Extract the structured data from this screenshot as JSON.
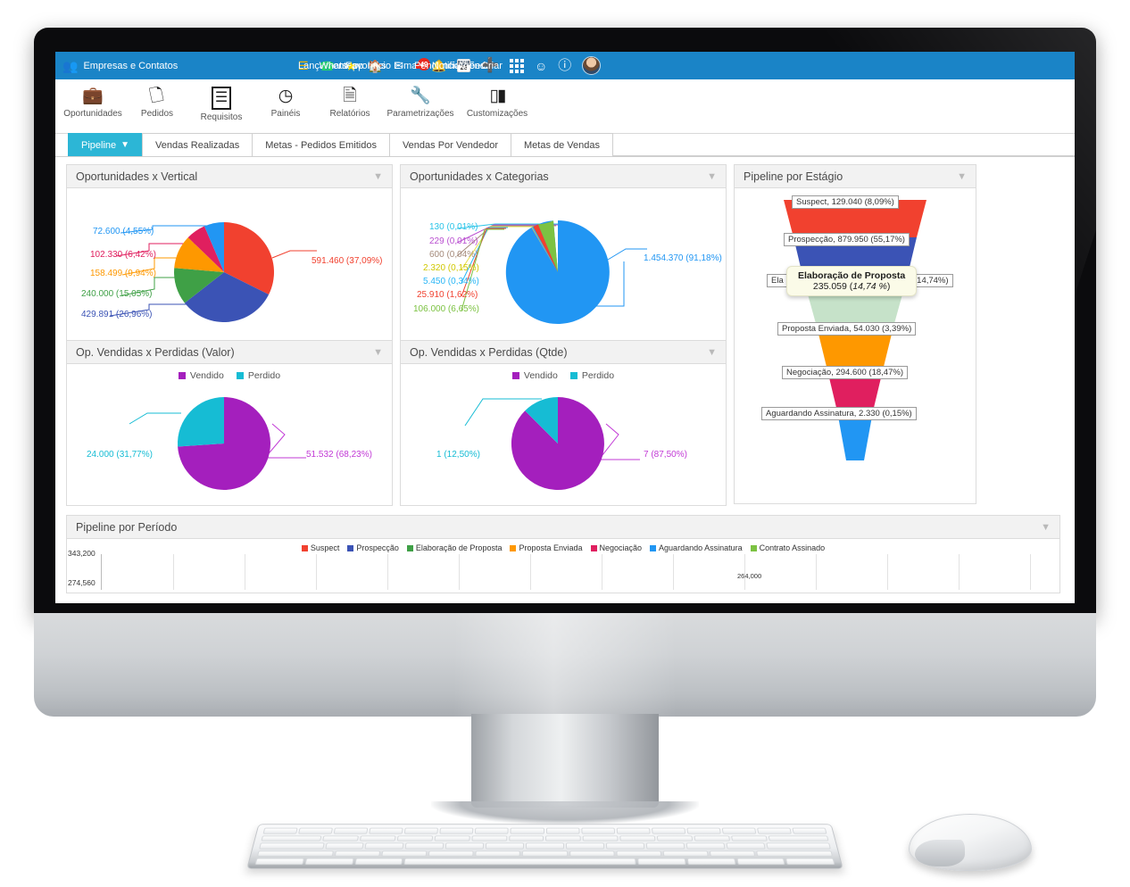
{
  "topbar": {
    "brand_label": "Empresas e Contatos",
    "brand_icon": "people-icon",
    "items": [
      {
        "label": "Lançamentos",
        "icon": "book-icon",
        "color": "#f0b400"
      },
      {
        "label": "Whatsapp",
        "icon": "whatsapp-icon",
        "color": "#25d366"
      },
      {
        "label": "Favoritos",
        "icon": "star-icon",
        "color": "#ffdd00"
      },
      {
        "label": "Início",
        "icon": "home-icon",
        "color": "#ffffff"
      },
      {
        "label": "E-mails",
        "icon": "envelope-icon",
        "color": "#ffffff"
      },
      {
        "label": "Pendências",
        "icon": "pending-icon",
        "color": "#e8281e",
        "badge": "49"
      },
      {
        "label": "Notificações",
        "icon": "bell-icon",
        "color": "#ffffff"
      },
      {
        "label": "Agenda",
        "icon": "calendar-icon",
        "color": "#ffffff",
        "cal_top": "Qui",
        "cal_day": "26"
      },
      {
        "label": "Criar",
        "icon": "plus-icon",
        "color": "#ffffff"
      }
    ],
    "apps_icon": "apps-grid-icon",
    "broadcast_icon": "user-broadcast-icon",
    "help_icon": "question-circle-icon",
    "avatar_icon": "avatar",
    "bg_color": "#1a84c7"
  },
  "module_toolbar": [
    {
      "label": "Oportunidades",
      "icon": "briefcase-icon",
      "glyph": "💼"
    },
    {
      "label": "Pedidos",
      "icon": "invoice-icon",
      "glyph": "🗒"
    },
    {
      "label": "Requisitos",
      "icon": "list-doc-icon",
      "glyph": "☰"
    },
    {
      "label": "Painéis",
      "icon": "gauge-icon",
      "glyph": "◔"
    },
    {
      "label": "Relatórios",
      "icon": "report-icon",
      "glyph": "🗎"
    },
    {
      "label": "Parametrizações",
      "icon": "wrench-icon",
      "glyph": "🔧"
    },
    {
      "label": "Customizações",
      "icon": "sliders-icon",
      "glyph": "▯▮"
    }
  ],
  "tabs": [
    {
      "label": "Pipeline",
      "active": true,
      "icon": "funnel-icon"
    },
    {
      "label": "Vendas Realizadas",
      "active": false
    },
    {
      "label": "Metas - Pedidos Emitidos",
      "active": false
    },
    {
      "label": "Vendas Por Vendedor",
      "active": false
    },
    {
      "label": "Metas de Vendas",
      "active": false
    }
  ],
  "panels": {
    "vertical": {
      "title": "Oportunidades x Vertical",
      "filter_icon": "filter-icon"
    },
    "categorias": {
      "title": "Oportunidades x Categorias",
      "filter_icon": "filter-icon"
    },
    "estagio": {
      "title": "Pipeline por Estágio",
      "filter_icon": "filter-icon"
    },
    "valor": {
      "title": "Op. Vendidas x Perdidas (Valor)",
      "filter_icon": "filter-icon"
    },
    "qtde": {
      "title": "Op. Vendidas x Perdidas (Qtde)",
      "filter_icon": "filter-icon"
    },
    "periodo": {
      "title": "Pipeline por Período",
      "filter_icon": "filter-icon"
    }
  },
  "chart_data": [
    {
      "id": "oportunidades_x_vertical",
      "type": "pie",
      "title": "Oportunidades x Vertical",
      "legend": "none",
      "labels": [
        "591.460 (37,09%)",
        "429.891 (26,96%)",
        "240.000 (15,05%)",
        "158.499 (9,94%)",
        "102.330 (6,42%)",
        "72.600 (4,55%)"
      ],
      "values": [
        591460,
        429891,
        240000,
        158499,
        102330,
        72600
      ],
      "percents": [
        37.09,
        26.96,
        15.05,
        9.94,
        6.42,
        4.55
      ],
      "colors": [
        "#f1412f",
        "#3b53b5",
        "#3fa046",
        "#fe9800",
        "#e01f5f",
        "#2196f3"
      ]
    },
    {
      "id": "oportunidades_x_categorias",
      "type": "pie",
      "title": "Oportunidades x Categorias",
      "legend": "none",
      "labels": [
        "1.454.370 (91,18%)",
        "106.000 (6,65%)",
        "25.910 (1,62%)",
        "5.450 (0,34%)",
        "2.320 (0,15%)",
        "600 (0,04%)",
        "229 (0,01%)",
        "130 (0,01%)"
      ],
      "values": [
        1454370,
        106000,
        25910,
        5450,
        2320,
        600,
        229,
        130
      ],
      "percents": [
        91.18,
        6.65,
        1.62,
        0.34,
        0.15,
        0.04,
        0.01,
        0.01
      ],
      "colors": [
        "#2196f3",
        "#7cc242",
        "#f1412f",
        "#29b6f6",
        "#e8e04a",
        "#a58b7b",
        "#b94fd0",
        "#29c4e8"
      ]
    },
    {
      "id": "pipeline_por_estagio",
      "type": "funnel",
      "title": "Pipeline por Estágio",
      "stages": [
        {
          "name": "Suspect",
          "label": "Suspect, 129.040 (8,09%)",
          "value": 129040,
          "percent": 8.09,
          "color": "#f1412f"
        },
        {
          "name": "Prospecção",
          "label": "Prospecção, 879.950 (55,17%)",
          "value": 879950,
          "percent": 55.17,
          "color": "#3b53b5"
        },
        {
          "name": "Elaboração de Proposta",
          "label": "Elaboração de Proposta, 235.059 (14,74%)",
          "value": 235059,
          "percent": 14.74,
          "color": "#c6e2c9"
        },
        {
          "name": "Proposta Enviada",
          "label": "Proposta Enviada, 54.030 (3,39%)",
          "value": 54030,
          "percent": 3.39,
          "color": "#fe9800"
        },
        {
          "name": "Negociação",
          "label": "Negociação, 294.600 (18,47%)",
          "value": 294600,
          "percent": 18.47,
          "color": "#e01f5f"
        },
        {
          "name": "Aguardando Assinatura",
          "label": "Aguardando Assinatura, 2.330 (0,15%)",
          "value": 2330,
          "percent": 0.15,
          "color": "#2196f3"
        }
      ],
      "tooltip": {
        "title": "Elaboração de Proposta",
        "value": "235.059",
        "percent": "14,74 %",
        "partial_behind": "Ela",
        "partial_right": "(14,74%)"
      }
    },
    {
      "id": "op_vendidas_x_perdidas_valor",
      "type": "pie",
      "title": "Op. Vendidas x Perdidas (Valor)",
      "legend_position": "top",
      "legend": [
        "Vendido",
        "Perdido"
      ],
      "categories": [
        "Vendido",
        "Perdido"
      ],
      "labels": [
        "51.532 (68,23%)",
        "24.000 (31,77%)"
      ],
      "values": [
        51532,
        24000
      ],
      "percents": [
        68.23,
        31.77
      ],
      "colors": [
        "#a41fbd",
        "#16bcd4"
      ]
    },
    {
      "id": "op_vendidas_x_perdidas_qtde",
      "type": "pie",
      "title": "Op. Vendidas x Perdidas (Qtde)",
      "legend_position": "top",
      "legend": [
        "Vendido",
        "Perdido"
      ],
      "categories": [
        "Vendido",
        "Perdido"
      ],
      "labels": [
        "7 (87,50%)",
        "1 (12,50%)"
      ],
      "values": [
        7,
        1
      ],
      "percents": [
        87.5,
        12.5
      ],
      "colors": [
        "#a41fbd",
        "#16bcd4"
      ]
    },
    {
      "id": "pipeline_por_periodo",
      "type": "bar",
      "title": "Pipeline por Período",
      "legend_position": "top",
      "series": [
        {
          "name": "Suspect",
          "color": "#f1412f"
        },
        {
          "name": "Prospecção",
          "color": "#3b53b5"
        },
        {
          "name": "Elaboração de Proposta",
          "color": "#3fa046"
        },
        {
          "name": "Proposta Enviada",
          "color": "#fe9800"
        },
        {
          "name": "Negociação",
          "color": "#e01f5f"
        },
        {
          "name": "Aguardando Assinatura",
          "color": "#2196f3"
        },
        {
          "name": "Contrato Assinado",
          "color": "#7cc242"
        }
      ],
      "ytick_labels": [
        "343,200",
        "274,560"
      ],
      "visible_data_labels": [
        "264,000"
      ],
      "note": "panel is cut off by the bottom edge of the screen"
    }
  ]
}
